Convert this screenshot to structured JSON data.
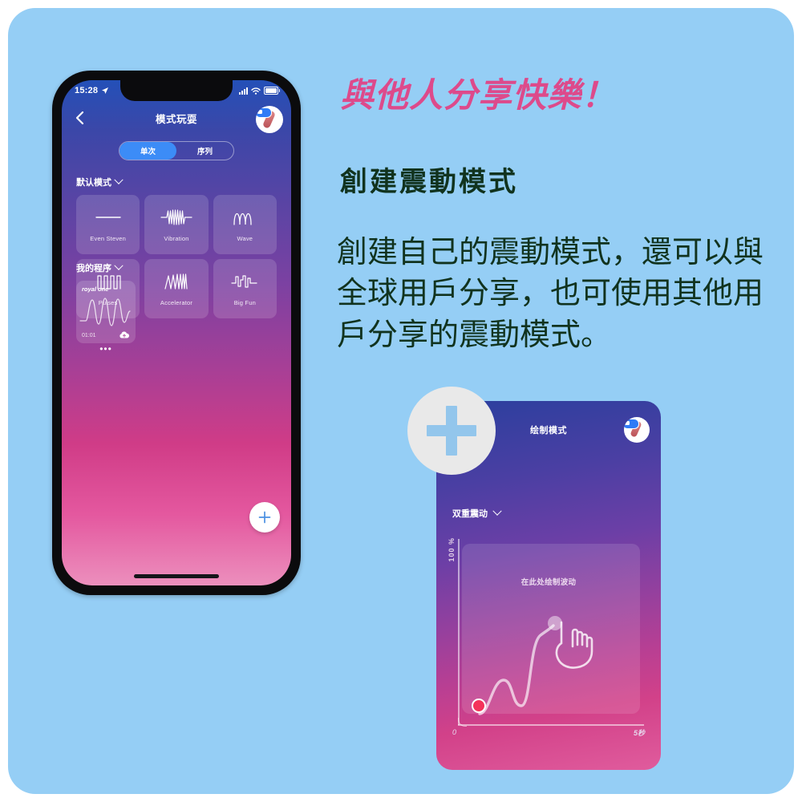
{
  "background": {
    "card_color": "#95CEF5",
    "page_color": "#ffffff"
  },
  "phone": {
    "status_bar": {
      "time": "15:28",
      "location_icon": "location-arrow-icon",
      "signal_icon": "cellular-signal-icon",
      "wifi_icon": "wifi-icon",
      "battery_icon": "battery-icon"
    },
    "nav": {
      "back_icon": "chevron-left-icon",
      "title": "模式玩耍",
      "avatar_icon": "toy-avatar-icon"
    },
    "segmented": {
      "options": [
        "单次",
        "序列"
      ],
      "selected": "单次"
    },
    "sections": [
      {
        "label": "默认模式",
        "chevron": "chevron-down-icon"
      },
      {
        "label": "我的程序",
        "chevron": "chevron-down-icon"
      }
    ],
    "patterns": [
      {
        "label": "Even Steven",
        "icon": "flat-line-waveform-icon"
      },
      {
        "label": "Vibration",
        "icon": "dense-zigzag-waveform-icon"
      },
      {
        "label": "Wave",
        "icon": "sine-waveform-icon"
      },
      {
        "label": "Pulses",
        "icon": "square-pulse-waveform-icon"
      },
      {
        "label": "Accelerator",
        "icon": "accelerating-zigzag-waveform-icon"
      },
      {
        "label": "Big Fun",
        "icon": "mixed-step-waveform-icon"
      }
    ],
    "program_card": {
      "name": "royal one",
      "duration": "01:01",
      "cloud_icon": "cloud-upload-icon",
      "more_icon": "more-dots-icon"
    },
    "fab": {
      "icon": "plus-icon",
      "color": "#3c8cf7"
    }
  },
  "copy": {
    "headline": "與他人分享快樂！",
    "headline_color": "#DD4A8B",
    "subhead": "創建震動模式",
    "body": "創建自己的震動模式，還可以與全球用戶分享，也可使用其他用戶分享的震動模式。",
    "body_color": "#11331E"
  },
  "draw_panel": {
    "plus_badge_icon": "plus-icon",
    "title": "绘制模式",
    "avatar_icon": "toy-avatar-icon",
    "mode": "双重震动",
    "mode_chevron": "chevron-down-icon",
    "y_axis_label": "100 %",
    "x_axis_start": "0",
    "x_axis_end": "5秒",
    "canvas_hint": "在此处绘制波动",
    "start_dot_color": "#F4335A",
    "hand_icon": "hand-pointer-icon"
  }
}
